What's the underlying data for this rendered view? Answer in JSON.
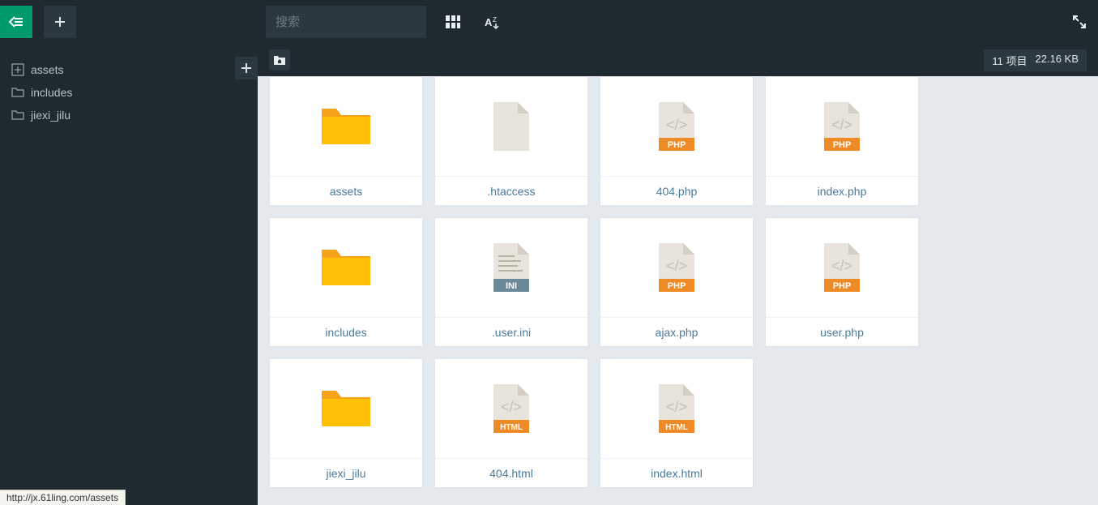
{
  "topbar": {
    "search_placeholder": "搜索"
  },
  "sidebar": {
    "items": [
      {
        "name": "assets",
        "icon": "plus-box"
      },
      {
        "name": "includes",
        "icon": "folder-outline"
      },
      {
        "name": "jiexi_jilu",
        "icon": "folder-outline"
      }
    ]
  },
  "status": {
    "count_label": "11 项目",
    "size_label": "22.16 KB"
  },
  "files": [
    {
      "name": "assets",
      "type": "folder"
    },
    {
      "name": ".htaccess",
      "type": "blank"
    },
    {
      "name": "404.php",
      "type": "php"
    },
    {
      "name": "index.php",
      "type": "php"
    },
    {
      "name": "includes",
      "type": "folder"
    },
    {
      "name": ".user.ini",
      "type": "ini"
    },
    {
      "name": "ajax.php",
      "type": "php"
    },
    {
      "name": "user.php",
      "type": "php"
    },
    {
      "name": "jiexi_jilu",
      "type": "folder"
    },
    {
      "name": "404.html",
      "type": "html"
    },
    {
      "name": "index.html",
      "type": "html"
    }
  ],
  "status_link": "http://jx.61ling.com/assets"
}
